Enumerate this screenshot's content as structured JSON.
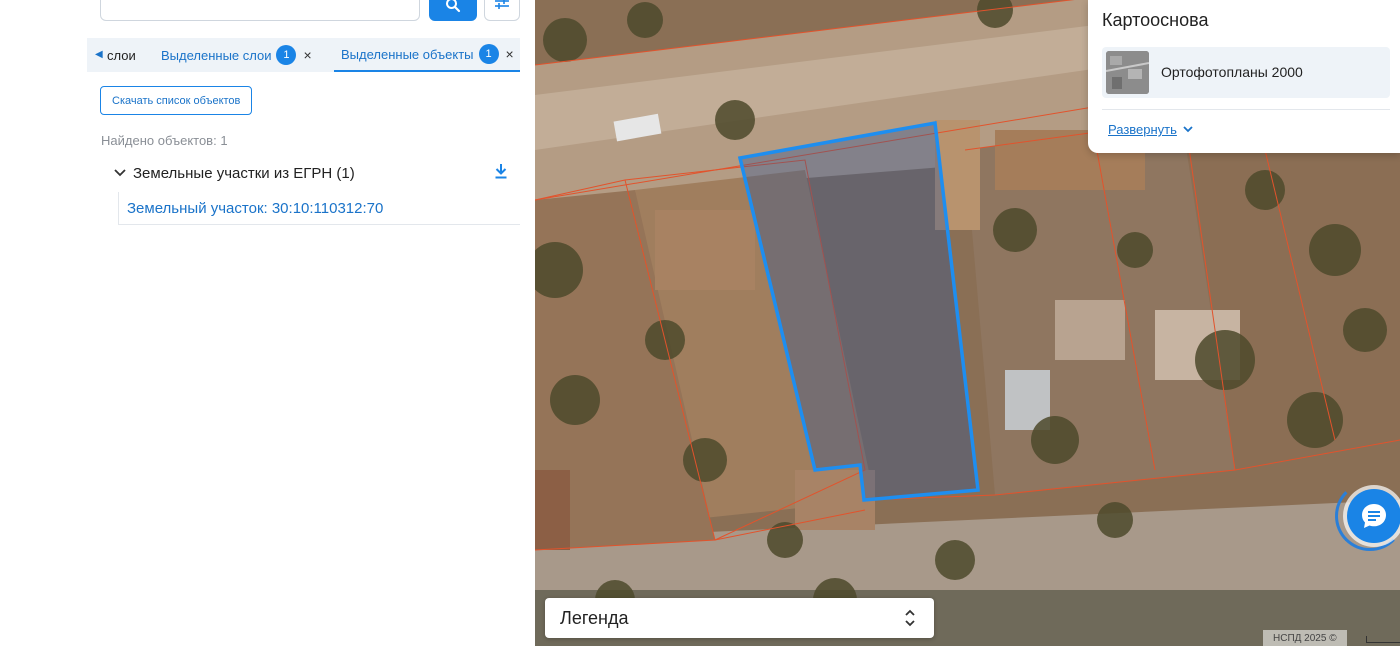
{
  "panel": {
    "tabs": [
      {
        "label": "слои"
      },
      {
        "label": "Выделенные слои",
        "badge": "1"
      },
      {
        "label": "Выделенные объекты",
        "badge": "1"
      }
    ],
    "close_glyph": "×",
    "download_button": "Скачать список объектов",
    "found_count": "Найдено объектов: 1",
    "group": {
      "title": "Земельные участки из ЕГРН (1)",
      "items": [
        {
          "label": "Земельный участок: 30:10:110312:70"
        }
      ]
    }
  },
  "basemap": {
    "title": "Картооснова",
    "selected": "Ортофотопланы 2000",
    "expand_label": "Развернуть"
  },
  "legend": {
    "label": "Легенда"
  },
  "attribution": "НСПД 2025 ©",
  "colors": {
    "accent": "#1a84e6",
    "parcel_outline": "#1e8ef0",
    "cadastral_lines": "#e2532c"
  },
  "icons": [
    "search-icon",
    "filter-icon",
    "chevron-left-icon",
    "close-icon",
    "chevron-down-icon",
    "download-icon",
    "up-down-icon",
    "chat-icon"
  ]
}
